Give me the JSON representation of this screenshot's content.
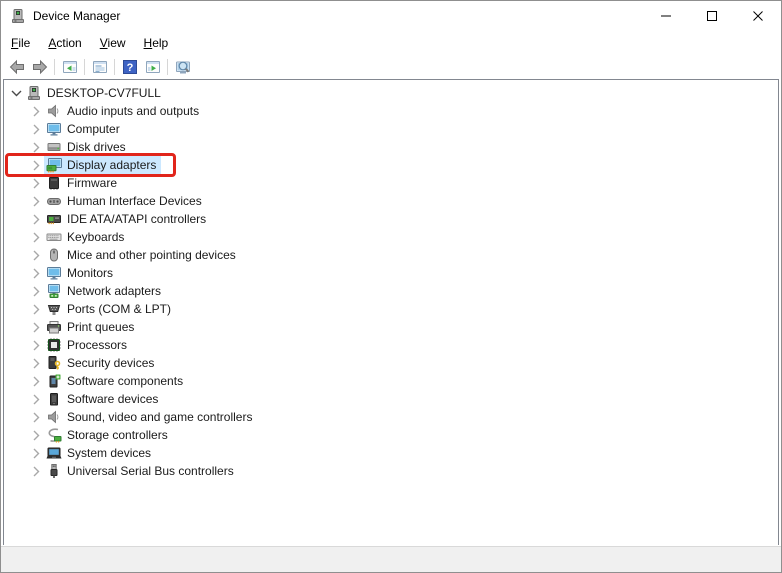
{
  "window": {
    "title": "Device Manager",
    "icon": "device-manager",
    "controls": [
      {
        "name": "minimize"
      },
      {
        "name": "maximize"
      },
      {
        "name": "close"
      }
    ]
  },
  "menu": {
    "items": [
      {
        "key": "F",
        "rest": "ile",
        "label": "File"
      },
      {
        "key": "A",
        "rest": "ction",
        "label": "Action"
      },
      {
        "key": "V",
        "rest": "iew",
        "label": "View"
      },
      {
        "key": "H",
        "rest": "elp",
        "label": "Help"
      }
    ]
  },
  "toolbar": {
    "items": [
      "back",
      "forward",
      "separator",
      "show-console-tree",
      "separator",
      "properties",
      "separator",
      "help",
      "show-action-pane",
      "separator",
      "scan-hardware"
    ]
  },
  "tree": {
    "root": {
      "label": "DESKTOP-CV7FULL",
      "icon": "device-manager",
      "expanded": true
    },
    "items": [
      {
        "label": "Audio inputs and outputs",
        "icon": "speaker"
      },
      {
        "label": "Computer",
        "icon": "monitor"
      },
      {
        "label": "Disk drives",
        "icon": "disk"
      },
      {
        "label": "Display adapters",
        "icon": "display-adapter",
        "selected": true,
        "annotated": true
      },
      {
        "label": "Firmware",
        "icon": "chip"
      },
      {
        "label": "Human Interface Devices",
        "icon": "gamepad"
      },
      {
        "label": "IDE ATA/ATAPI controllers",
        "icon": "ide-card"
      },
      {
        "label": "Keyboards",
        "icon": "keyboard"
      },
      {
        "label": "Mice and other pointing devices",
        "icon": "mouse"
      },
      {
        "label": "Monitors",
        "icon": "monitor"
      },
      {
        "label": "Network adapters",
        "icon": "network"
      },
      {
        "label": "Ports (COM & LPT)",
        "icon": "port"
      },
      {
        "label": "Print queues",
        "icon": "printer"
      },
      {
        "label": "Processors",
        "icon": "processor"
      },
      {
        "label": "Security devices",
        "icon": "security"
      },
      {
        "label": "Software components",
        "icon": "software-component"
      },
      {
        "label": "Software devices",
        "icon": "software-device"
      },
      {
        "label": "Sound, video and game controllers",
        "icon": "speaker"
      },
      {
        "label": "Storage controllers",
        "icon": "storage"
      },
      {
        "label": "System devices",
        "icon": "system"
      },
      {
        "label": "Universal Serial Bus controllers",
        "icon": "usb"
      }
    ]
  },
  "status_bar": {
    "text": ""
  },
  "colors": {
    "selection_highlight": "#cce8ff",
    "annotation_box": "#e1251b",
    "help_blue": "#3e63c4",
    "accent_green": "#3fae49",
    "statusbar_bg": "#f0f0f0"
  }
}
